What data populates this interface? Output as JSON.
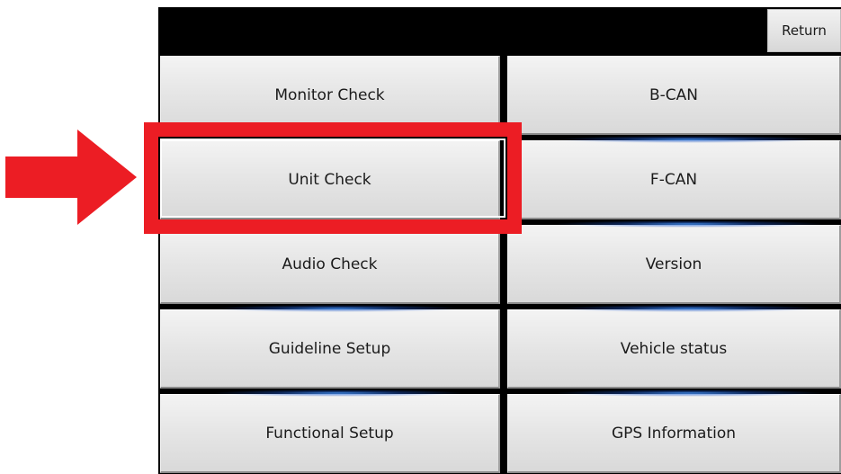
{
  "header": {
    "return_label": "Return"
  },
  "menu": {
    "left": [
      {
        "label": "Monitor Check"
      },
      {
        "label": "Unit Check"
      },
      {
        "label": "Audio Check"
      },
      {
        "label": "Guideline Setup"
      },
      {
        "label": "Functional Setup"
      }
    ],
    "right": [
      {
        "label": "B-CAN"
      },
      {
        "label": "F-CAN"
      },
      {
        "label": "Version"
      },
      {
        "label": "Vehicle status"
      },
      {
        "label": "GPS Information"
      }
    ]
  },
  "annotation": {
    "highlighted_item": "Unit Check",
    "highlight_color": "#ec1d24",
    "arrow_icon": "right-arrow-icon"
  }
}
